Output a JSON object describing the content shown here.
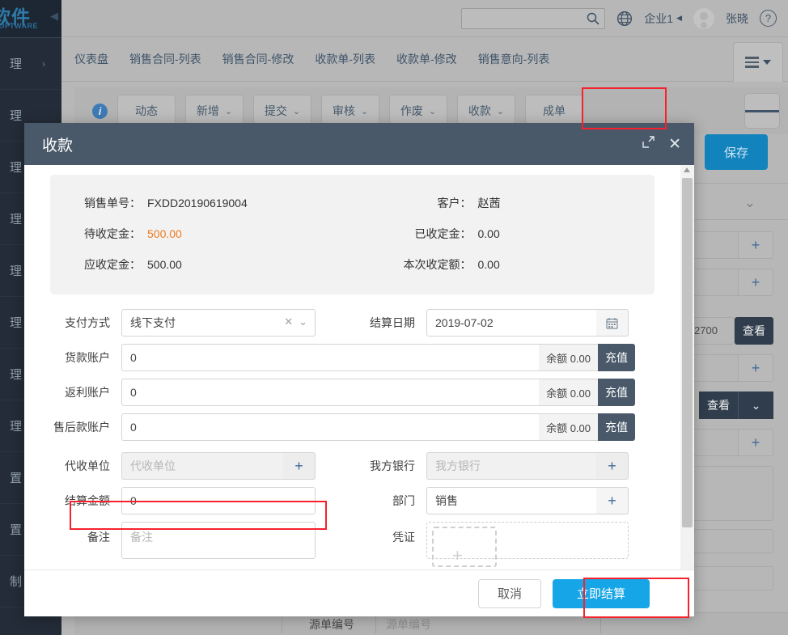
{
  "brand": {
    "cn": "软件",
    "en": "SOFTWARE",
    "collapse_icon": "caret-left"
  },
  "sidebar": {
    "items": [
      {
        "label": "理",
        "chevron": "›"
      },
      {
        "label": "理",
        "chevron": ""
      },
      {
        "label": "理",
        "chevron": ""
      },
      {
        "label": "理",
        "chevron": ""
      },
      {
        "label": "理",
        "chevron": ""
      },
      {
        "label": "理",
        "chevron": ""
      },
      {
        "label": "理",
        "chevron": ""
      },
      {
        "label": "理",
        "chevron": ""
      },
      {
        "label": "置",
        "chevron": ""
      },
      {
        "label": "置",
        "chevron": ""
      },
      {
        "label": "制",
        "chevron": ""
      }
    ]
  },
  "topbar": {
    "search_placeholder": "",
    "search_value": "",
    "search_icon": "search-icon",
    "globe_icon": "globe-icon",
    "enterprise": "企业1",
    "enterprise_caret": "◀",
    "user_name": "张晓",
    "help_icon": "?"
  },
  "tabs": [
    {
      "label": "仪表盘"
    },
    {
      "label": "销售合同-列表"
    },
    {
      "label": "销售合同-修改"
    },
    {
      "label": "收款单-列表"
    },
    {
      "label": "收款单-修改"
    },
    {
      "label": "销售意向-列表"
    }
  ],
  "toolbar": {
    "info_icon": "i",
    "buttons": [
      {
        "label": "动态",
        "caret": ""
      },
      {
        "label": "新增",
        "caret": "⌄"
      },
      {
        "label": "提交",
        "caret": "⌄"
      },
      {
        "label": "审核",
        "caret": "⌄"
      },
      {
        "label": "作废",
        "caret": "⌄"
      },
      {
        "label": "收款",
        "caret": "⌄",
        "highlighted": true
      },
      {
        "label": "成单",
        "caret": ""
      }
    ],
    "menu_icon": "hamburger-icon"
  },
  "background": {
    "save_label": "保存",
    "collapse_chevron": "⌄",
    "truncated_value": "2700",
    "view_label": "查看",
    "view_label2": "查看",
    "dropdown_caret": "⌄",
    "plus": "+",
    "bottom_row": {
      "label": "源单编号",
      "placeholder": "源单编号"
    }
  },
  "modal": {
    "title": "收款",
    "expand_icon": "expand-icon",
    "close_icon": "✕",
    "summary": [
      {
        "label": "销售单号：",
        "value": "FXDD20190619004",
        "accent": false
      },
      {
        "label": "客户：",
        "value": "赵茜",
        "accent": false
      },
      {
        "label": "待收定金：",
        "value": "500.00",
        "accent": true
      },
      {
        "label": "已收定金：",
        "value": "0.00",
        "accent": false
      },
      {
        "label": "应收定金：",
        "value": "500.00",
        "accent": false
      },
      {
        "label": "本次收定额：",
        "value": "0.00",
        "accent": false
      }
    ],
    "fields": {
      "pay_method": {
        "label": "支付方式",
        "value": "线下支付",
        "clear_icon": "✕",
        "caret_icon": "⌄"
      },
      "settle_date": {
        "label": "结算日期",
        "value": "2019-07-02",
        "calendar_icon": "calendar-icon"
      },
      "goods_account": {
        "label": "货款账户",
        "value": "0",
        "balance": "余额 0.00",
        "recharge": "充值"
      },
      "rebate_account": {
        "label": "返利账户",
        "value": "0",
        "balance": "余额 0.00",
        "recharge": "充值"
      },
      "aftersale_account": {
        "label": "售后款账户",
        "value": "0",
        "balance": "余额 0.00",
        "recharge": "充值"
      },
      "collect_unit": {
        "label": "代收单位",
        "placeholder": "代收单位",
        "value": "",
        "plus": "+"
      },
      "our_bank": {
        "label": "我方银行",
        "placeholder": "我方银行",
        "value": "",
        "plus": "+"
      },
      "settle_amount": {
        "label": "结算金额",
        "value": "0",
        "highlighted": true
      },
      "department": {
        "label": "部门",
        "value": "销售",
        "plus": "+"
      },
      "remark": {
        "label": "备注",
        "placeholder": "备注",
        "value": ""
      },
      "voucher": {
        "label": "凭证",
        "upload_icon": "upload-plus-icon"
      }
    },
    "footer": {
      "cancel": "取消",
      "confirm": "立即结算",
      "confirm_highlighted": true
    }
  },
  "colors": {
    "accent_orange": "#ee7a1e",
    "primary_blue": "#16a5e6",
    "save_blue": "#1283bd",
    "modal_header": "#49596a",
    "highlight_red": "#f5222d",
    "sidebar_dark": "#232c38"
  }
}
